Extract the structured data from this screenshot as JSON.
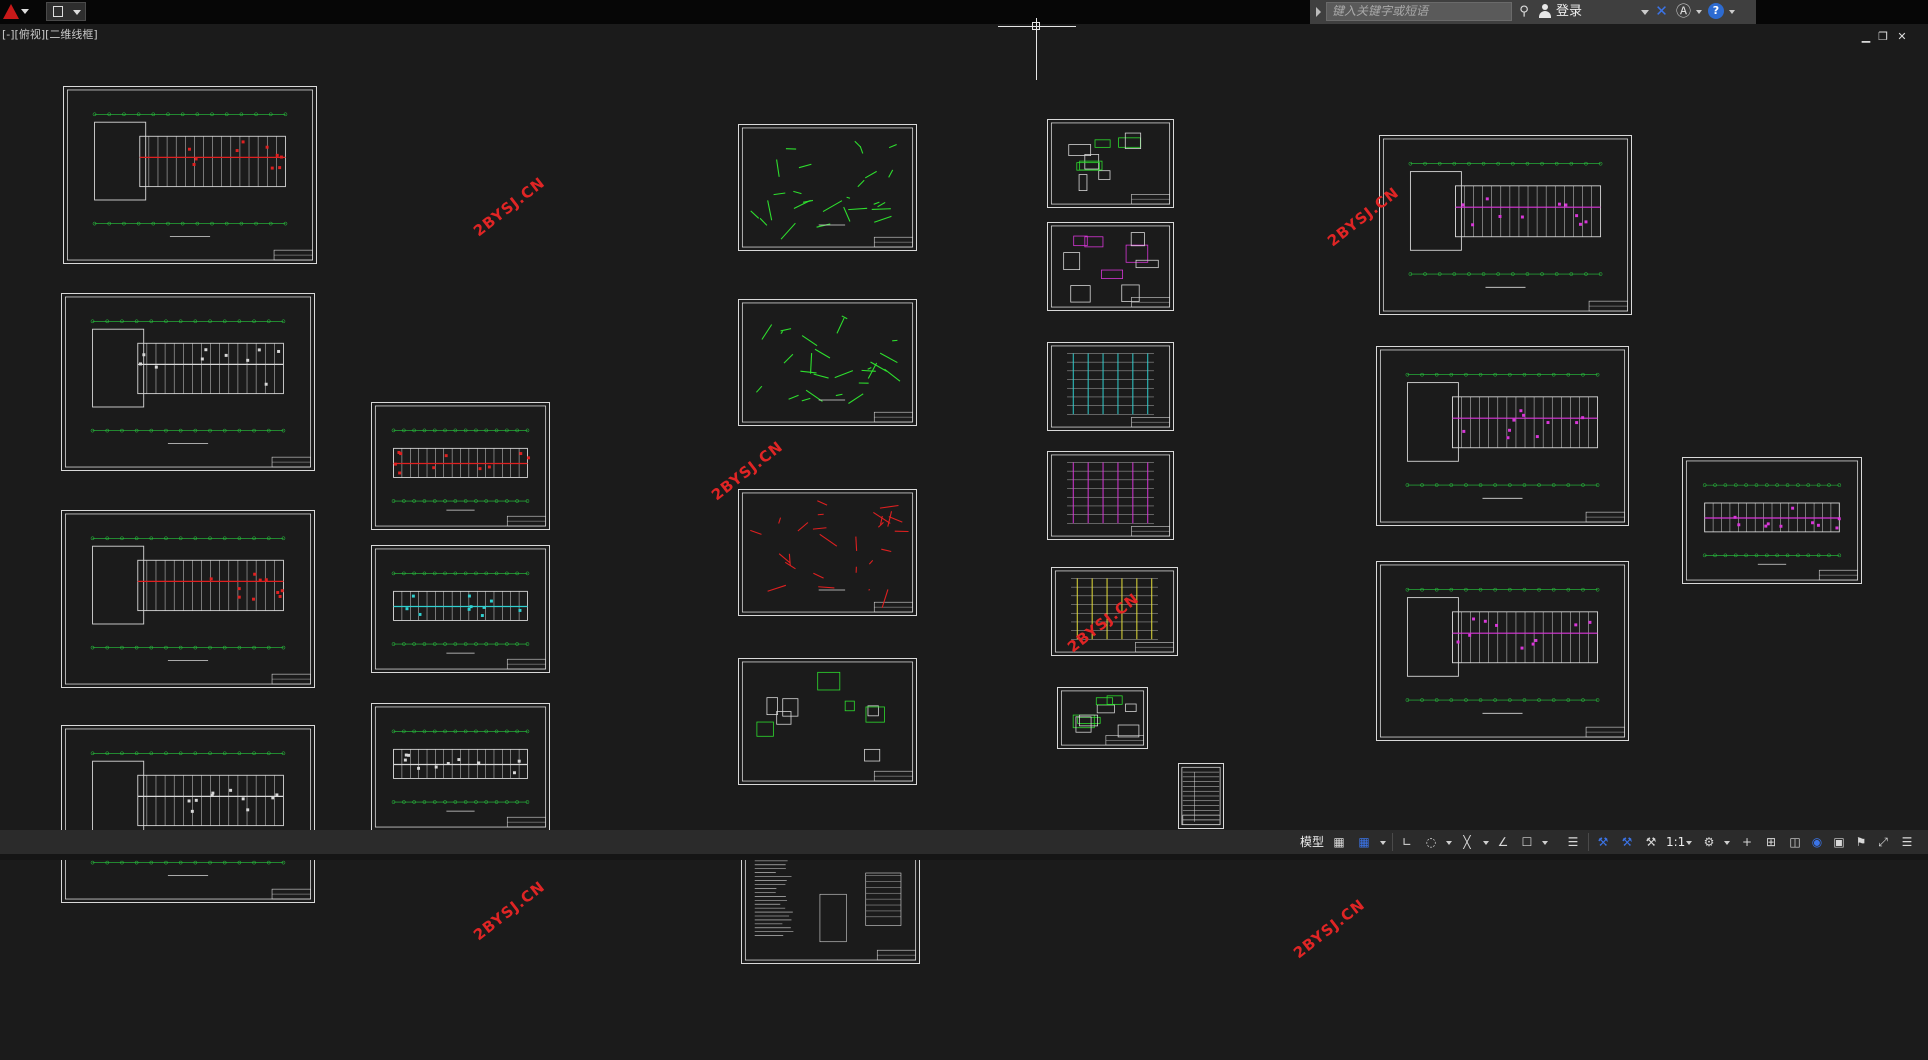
{
  "titlebar": {
    "app_icon": "autocad-logo-icon",
    "quick_access_icon": "document-icon",
    "search_placeholder": "键入关键字或短语",
    "login_label": "登录",
    "icons": [
      "binoculars-icon",
      "user-icon",
      "exchange-icon",
      "autodesk-a360-icon",
      "help-icon"
    ]
  },
  "viewport": {
    "label": "[-][俯视][二维线框]"
  },
  "watermarks": [
    {
      "text": "2BYSJ.CN"
    },
    {
      "text": "2BYSJ.CN"
    },
    {
      "text": "2BYSJ.CN"
    },
    {
      "text": "2BYSJ.CN"
    },
    {
      "text": "2BYSJ.CN"
    },
    {
      "text": "2BYSJ.CN"
    }
  ],
  "drawings": {
    "colors": {
      "frame": "#d9d9d9",
      "axis": "#27c93f",
      "wall": "#d8d8d8",
      "red": "#e02020",
      "magenta": "#d936d9",
      "cyan": "#2fd0d0",
      "yellow": "#e8e23a",
      "green": "#2edf2e"
    },
    "sheet_count": 25
  },
  "statusbar": {
    "model_label": "模型",
    "scale_label": "1:1",
    "icons": [
      "grid-icon",
      "snap-icon",
      "ortho-icon",
      "polar-icon",
      "osnap-icon",
      "otrack-icon",
      "lineweight-icon",
      "transparency-icon",
      "annotation-visibility-icon",
      "auto-scale-icon",
      "annotation-scale-icon",
      "workspace-gear-icon",
      "plus-icon",
      "units-icon",
      "isolate-objects-icon",
      "hardware-acceleration-icon",
      "clean-screen-icon",
      "customize-icon"
    ]
  }
}
